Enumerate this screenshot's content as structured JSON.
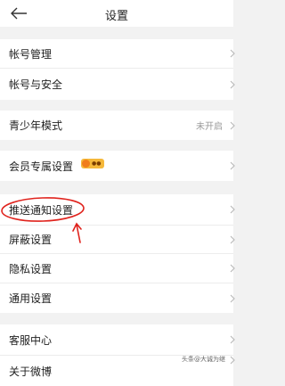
{
  "header": {
    "title": "设置",
    "back_icon": "back-arrow-icon"
  },
  "groups": {
    "account": {
      "items": [
        {
          "label": "帐号管理"
        },
        {
          "label": "帐号与安全"
        }
      ]
    },
    "youth": {
      "label": "青少年模式",
      "value": "未开启"
    },
    "vip": {
      "label": "会员专属设置",
      "badge_icon": "vip-crown-icon"
    },
    "privacy": {
      "items": [
        {
          "label": "推送通知设置"
        },
        {
          "label": "屏蔽设置"
        },
        {
          "label": "隐私设置"
        },
        {
          "label": "通用设置"
        }
      ]
    },
    "service": {
      "items": [
        {
          "label": "客服中心"
        },
        {
          "label": "关于微博"
        }
      ]
    }
  },
  "annotation": {
    "highlight_color": "#e0231d"
  },
  "colors": {
    "background": "#f2f2f2",
    "row_background": "#ffffff",
    "secondary_text": "#999999"
  },
  "watermark": "头条@大诚为继"
}
